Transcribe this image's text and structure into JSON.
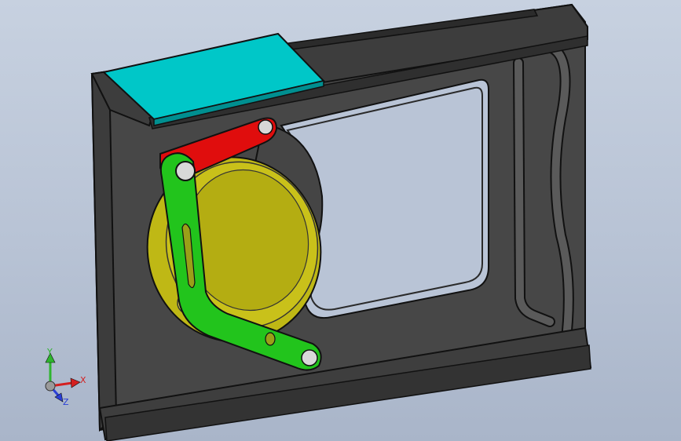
{
  "viewport": {
    "background": "#b9c4d6"
  },
  "model": {
    "frame_color": "#4b4b4b",
    "edge_color": "#111111",
    "pad_color": "#00c7c8",
    "red_link_color": "#e00d0d",
    "green_link_color": "#22c41c",
    "wheel_color": "#c9c11a"
  },
  "triad": {
    "x_label": "X",
    "y_label": "Y",
    "z_label": "Z",
    "x_color": "#d42020",
    "y_color": "#2fb52f",
    "z_color": "#2a3fd6"
  }
}
